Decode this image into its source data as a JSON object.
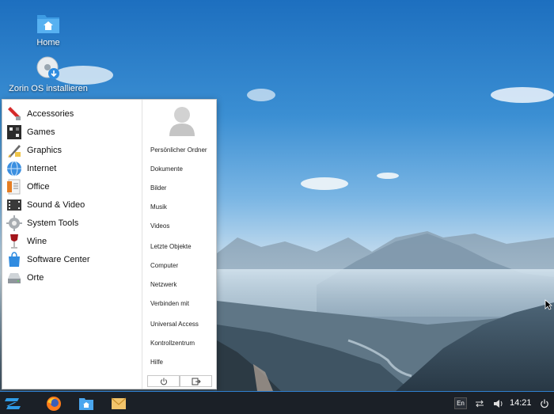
{
  "desktop": {
    "icons": [
      {
        "label": "Home",
        "icon": "folder-home-icon"
      },
      {
        "label": "Zorin OS installieren",
        "icon": "disc-install-icon"
      }
    ]
  },
  "menu": {
    "categories": [
      {
        "label": "Accessories",
        "icon": "accessories-icon"
      },
      {
        "label": "Games",
        "icon": "games-icon"
      },
      {
        "label": "Graphics",
        "icon": "graphics-icon"
      },
      {
        "label": "Internet",
        "icon": "internet-icon"
      },
      {
        "label": "Office",
        "icon": "office-icon"
      },
      {
        "label": "Sound & Video",
        "icon": "sound-video-icon"
      },
      {
        "label": "System Tools",
        "icon": "system-tools-icon"
      },
      {
        "label": "Wine",
        "icon": "wine-icon"
      },
      {
        "label": "Software Center",
        "icon": "software-center-icon"
      },
      {
        "label": "Orte",
        "icon": "places-drive-icon"
      }
    ],
    "places": [
      "Persönlicher Ordner",
      "Dokumente",
      "Bilder",
      "Musik",
      "Videos",
      "Letzte Objekte",
      "Computer",
      "Netzwerk",
      "Verbinden mit",
      "Universal Access",
      "Kontrollzentrum",
      "Hilfe"
    ]
  },
  "taskbar": {
    "apps": [
      "zorin-menu-icon",
      "firefox-icon",
      "files-icon",
      "mail-icon"
    ],
    "tray": {
      "keyboard_layout": "En",
      "clock": "14:21"
    }
  },
  "colors": {
    "accent": "#2f7fd0",
    "taskbar": "#1b2027"
  }
}
